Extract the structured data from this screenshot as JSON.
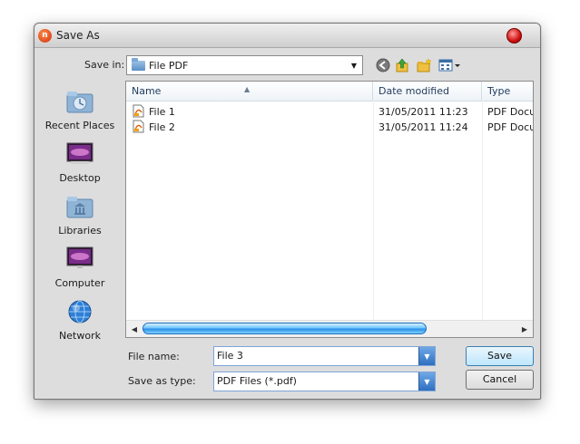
{
  "window": {
    "title": "Save As"
  },
  "save_in": {
    "label": "Save in:",
    "value": "File PDF"
  },
  "places": [
    {
      "label": "Recent Places",
      "icon": "recent-places-icon"
    },
    {
      "label": "Desktop",
      "icon": "desktop-icon"
    },
    {
      "label": "Libraries",
      "icon": "libraries-icon"
    },
    {
      "label": "Computer",
      "icon": "computer-icon"
    },
    {
      "label": "Network",
      "icon": "network-icon"
    }
  ],
  "file_list": {
    "columns": [
      "Name",
      "Date modified",
      "Type"
    ],
    "rows": [
      {
        "name": "File 1",
        "date": "31/05/2011 11:23",
        "type": "PDF Docum"
      },
      {
        "name": "File 2",
        "date": "31/05/2011 11:24",
        "type": "PDF Docum"
      }
    ]
  },
  "file_name": {
    "label": "File name:",
    "value": "File 3"
  },
  "save_as_type": {
    "label": "Save as type:",
    "value": "PDF Files (*.pdf)"
  },
  "buttons": {
    "save": "Save",
    "cancel": "Cancel"
  },
  "colors": {
    "accent": "#2f6fbf",
    "close": "#d01010",
    "scroll_thumb": "#2a8fe6"
  }
}
